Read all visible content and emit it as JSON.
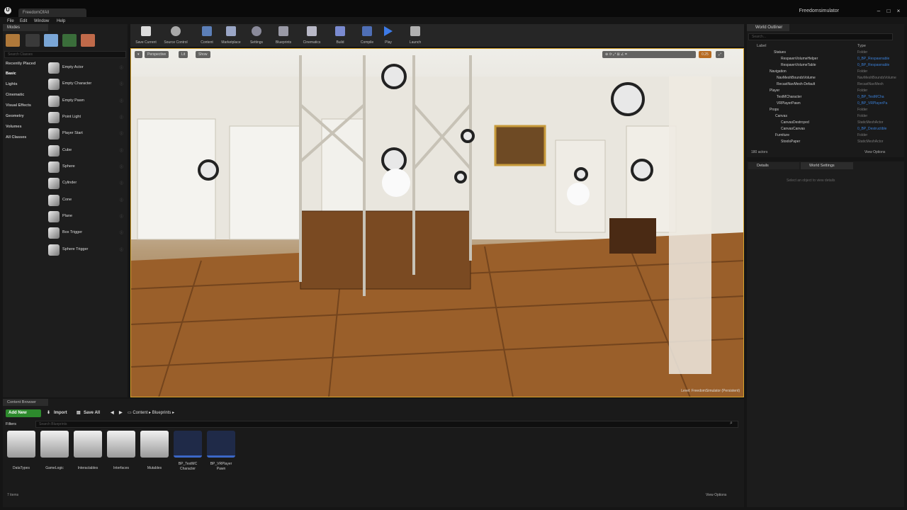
{
  "window": {
    "doc_tab": "FreedomOfAll",
    "app_name": "Freedomsimulator",
    "menu": [
      "File",
      "Edit",
      "Window",
      "Help"
    ],
    "controls": [
      "minimize",
      "maximize",
      "close"
    ]
  },
  "modes": {
    "tab_label": "Modes",
    "search_placeholder": "Search Classes",
    "categories": [
      "Recently Placed",
      "Basic",
      "Lights",
      "Cinematic",
      "Visual Effects",
      "Geometry",
      "Volumes",
      "All Classes"
    ],
    "items": [
      "Empty Actor",
      "Empty Character",
      "Empty Pawn",
      "Point Light",
      "Player Start",
      "Cube",
      "Sphere",
      "Cylinder",
      "Cone",
      "Plane",
      "Box Trigger",
      "Sphere Trigger"
    ]
  },
  "toolbar": {
    "buttons": [
      "Save Current",
      "Source Control",
      "Content",
      "Marketplace",
      "Settings",
      "Blueprints",
      "Cinematics",
      "Build",
      "Compile",
      "Play",
      "Launch"
    ]
  },
  "viewport": {
    "view_mode_buttons": [
      "Perspective",
      "Lit",
      "Show"
    ],
    "camera_speed": "0.25",
    "level_status": "Level: FreedomSimulator (Persistent)"
  },
  "outliner": {
    "tab_label": "World Outliner",
    "search_placeholder": "Search...",
    "col_label": "Label",
    "col_type": "Type",
    "rows": [
      {
        "name": "Statues",
        "type": "Folder",
        "link": false
      },
      {
        "name": "RespawnVolumeHelper",
        "type": "0_BP_Respawnable",
        "link": true
      },
      {
        "name": "RespawnVolumeTable",
        "type": "0_BP_Respawnable",
        "link": true
      },
      {
        "name": "Navigation",
        "type": "Folder",
        "link": false
      },
      {
        "name": "NavMeshBoundsVolume",
        "type": "NavMeshBoundsVolume",
        "link": false
      },
      {
        "name": "RecastNavMesh-Default",
        "type": "RecastNavMesh",
        "link": false
      },
      {
        "name": "Player",
        "type": "Folder",
        "link": false
      },
      {
        "name": "TestMCharacter",
        "type": "0_BP_TestMCha",
        "link": true
      },
      {
        "name": "VRPlayerPawn",
        "type": "0_BP_VRPlayerPa",
        "link": true
      },
      {
        "name": "Props",
        "type": "Folder",
        "link": false
      },
      {
        "name": "Canvas",
        "type": "Folder",
        "link": false
      },
      {
        "name": "CanvasDestroyed",
        "type": "StaticMeshActor",
        "link": false
      },
      {
        "name": "CanvasCanvas",
        "type": "0_BP_Destructible",
        "link": true
      },
      {
        "name": "Furniture",
        "type": "Folder",
        "link": false
      },
      {
        "name": "StoolsPaper",
        "type": "StaticMeshActor",
        "link": false
      }
    ],
    "actor_count": "180 actors",
    "view_options": "View Options"
  },
  "details": {
    "tabs": [
      "Details",
      "World Settings"
    ],
    "empty_text": "Select an object to view details"
  },
  "content_browser": {
    "tab_label": "Content Browser",
    "add_new": "Add New",
    "import": "Import",
    "save_all": "Save All",
    "path": [
      "Content",
      "Blueprints"
    ],
    "filters": "Filters",
    "search_placeholder": "Search Blueprints",
    "assets": [
      {
        "label": "DataTypes",
        "kind": "folder"
      },
      {
        "label": "GameLogic",
        "kind": "folder"
      },
      {
        "label": "Interactables",
        "kind": "folder"
      },
      {
        "label": "Interfaces",
        "kind": "folder"
      },
      {
        "label": "Mutables",
        "kind": "folder"
      },
      {
        "label": "BP_TestMC Character",
        "kind": "blueprint"
      },
      {
        "label": "BP_VRPlayer Pawn",
        "kind": "blueprint"
      }
    ],
    "item_count": "7 items",
    "view_options": "View Options"
  },
  "colors": {
    "accent_green": "#2d8a2d",
    "link_blue": "#3a7fd6",
    "selection_gold": "#d7a32a"
  }
}
